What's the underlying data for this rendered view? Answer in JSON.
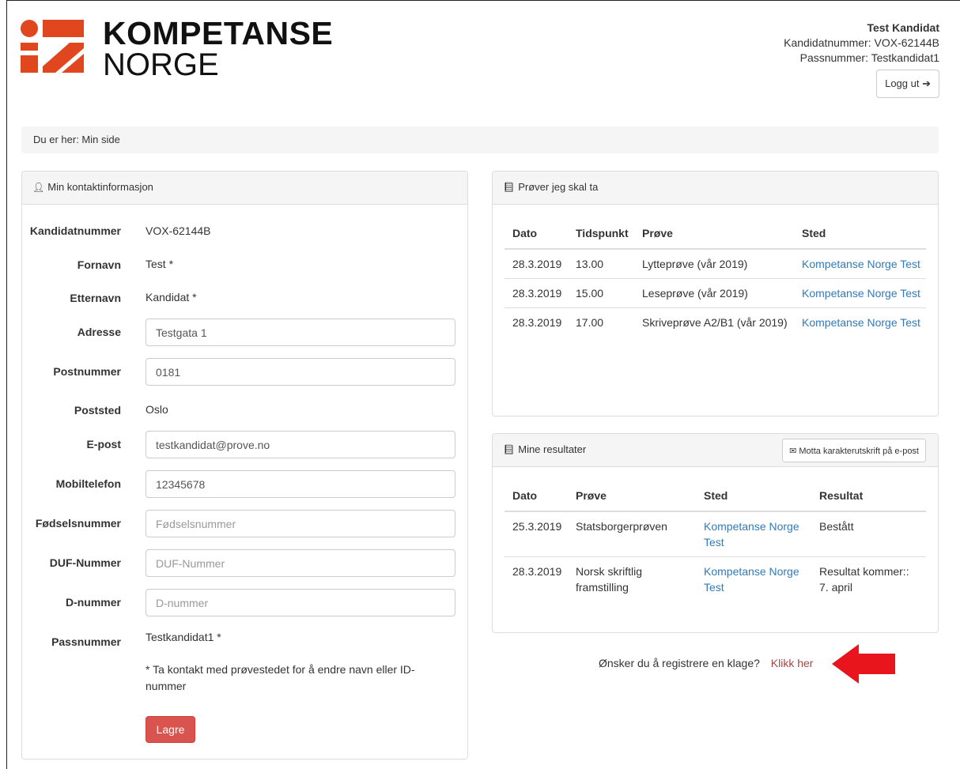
{
  "brand": {
    "word1": "KOMPETANSE",
    "word2": "NORGE",
    "logo_color": "#e0471f"
  },
  "user": {
    "name": "Test Kandidat",
    "kandidatnummer_line": "Kandidatnummer: VOX-62144B",
    "passnummer_line": "Passnummer: Testkandidat1",
    "logout_label": "Logg ut",
    "logout_icon": "sign-out-icon"
  },
  "breadcrumb": "Du er her: Min side",
  "contact": {
    "heading": "Min kontaktinformasjon",
    "fields": {
      "kandidatnummer": {
        "label": "Kandidatnummer",
        "value": "VOX-62144B"
      },
      "fornavn": {
        "label": "Fornavn",
        "value": "Test *"
      },
      "etternavn": {
        "label": "Etternavn",
        "value": "Kandidat *"
      },
      "adresse": {
        "label": "Adresse",
        "value": "Testgata 1"
      },
      "postnummer": {
        "label": "Postnummer",
        "value": "0181"
      },
      "poststed": {
        "label": "Poststed",
        "value": "Oslo"
      },
      "epost": {
        "label": "E-post",
        "value": "testkandidat@prove.no"
      },
      "mobil": {
        "label": "Mobiltelefon",
        "value": "12345678"
      },
      "fodselsnummer": {
        "label": "Fødselsnummer",
        "value": "",
        "placeholder": "Fødselsnummer"
      },
      "duf": {
        "label": "DUF-Nummer",
        "value": "",
        "placeholder": "DUF-Nummer"
      },
      "dnummer": {
        "label": "D-nummer",
        "value": "",
        "placeholder": "D-nummer"
      },
      "passnummer": {
        "label": "Passnummer",
        "value": "Testkandidat1 *"
      }
    },
    "note": "* Ta kontakt med prøvestedet for å endre navn eller ID-nummer",
    "save_label": "Lagre",
    "save_color": "#d9534f"
  },
  "tests": {
    "heading": "Prøver jeg skal ta",
    "columns": [
      "Dato",
      "Tidspunkt",
      "Prøve",
      "Sted"
    ],
    "rows": [
      {
        "dato": "28.3.2019",
        "tid": "13.00",
        "prove": "Lytteprøve (vår 2019)",
        "sted": "Kompetanse Norge Test"
      },
      {
        "dato": "28.3.2019",
        "tid": "15.00",
        "prove": "Leseprøve (vår 2019)",
        "sted": "Kompetanse Norge Test"
      },
      {
        "dato": "28.3.2019",
        "tid": "17.00",
        "prove": "Skriveprøve A2/B1 (vår 2019)",
        "sted": "Kompetanse Norge Test"
      }
    ]
  },
  "results": {
    "heading": "Mine resultater",
    "email_button": "Motta karakterutskrift på e-post",
    "columns": [
      "Dato",
      "Prøve",
      "Sted",
      "Resultat"
    ],
    "rows": [
      {
        "dato": "25.3.2019",
        "prove": "Statsborgerprøven",
        "sted": "Kompetanse Norge Test",
        "resultat": "Bestått"
      },
      {
        "dato": "28.3.2019",
        "prove": "Norsk skriftlig framstilling",
        "sted": "Kompetanse Norge Test",
        "resultat": "Resultat kommer:: 7. april"
      }
    ]
  },
  "complaint": {
    "question": "Ønsker du å registrere en klage?",
    "link": "Klikk her",
    "arrow_color": "#e8161c"
  },
  "colors": {
    "link": "#337ab7",
    "danger_link": "#a94442"
  }
}
